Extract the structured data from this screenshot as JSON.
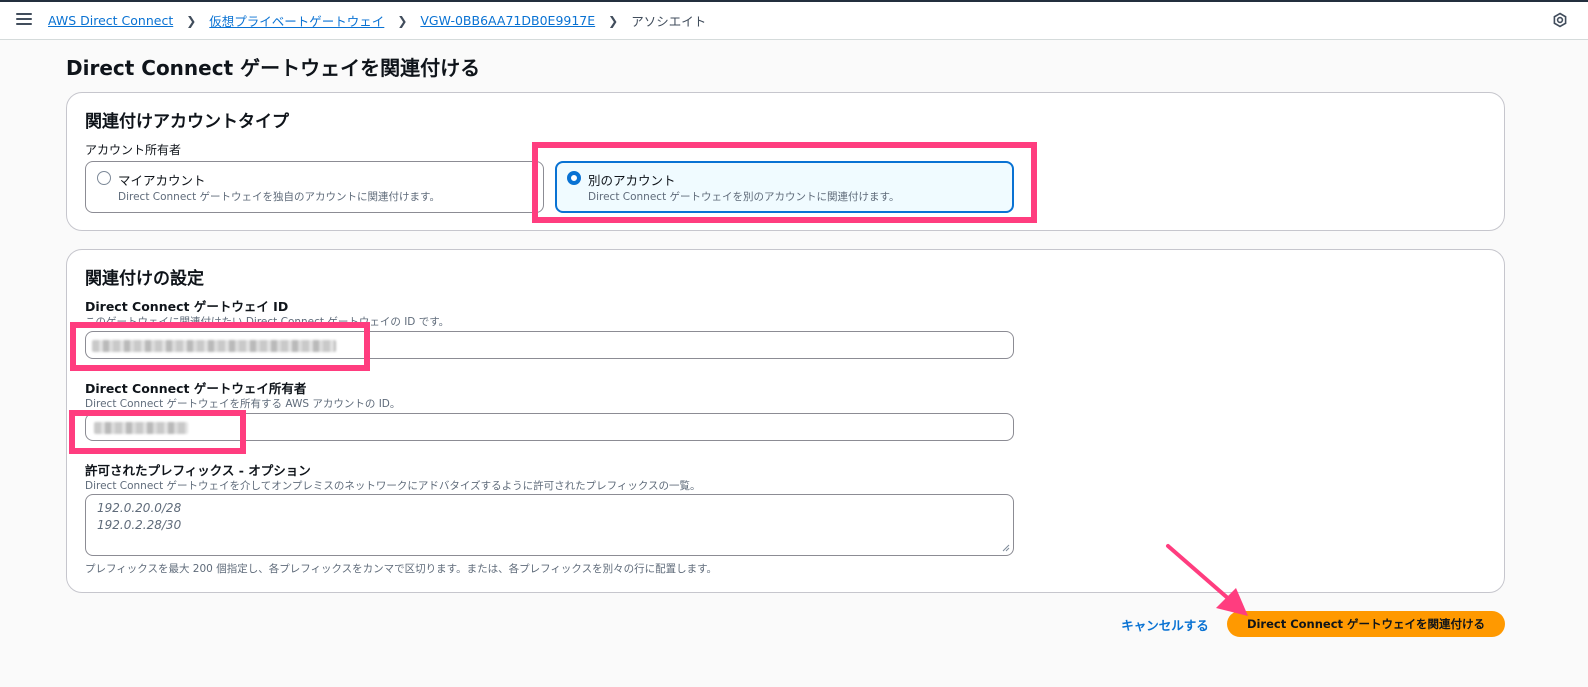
{
  "header": {
    "breadcrumbs": [
      "AWS Direct Connect",
      "仮想プライベートゲートウェイ",
      "VGW-0BB6AA71DB0E9917E"
    ],
    "current": "アソシエイト"
  },
  "page": {
    "title": "Direct Connect ゲートウェイを関連付ける"
  },
  "account_type": {
    "heading": "関連付けアカウントタイプ",
    "owner_label": "アカウント所有者",
    "options": [
      {
        "title": "マイアカウント",
        "description": "Direct Connect ゲートウェイを独自のアカウントに関連付けます。",
        "selected": false
      },
      {
        "title": "別のアカウント",
        "description": "Direct Connect ゲートウェイを別のアカウントに関連付けます。",
        "selected": true
      }
    ]
  },
  "settings": {
    "heading": "関連付けの設定",
    "gateway_id": {
      "label": "Direct Connect ゲートウェイ ID",
      "description": "このゲートウェイに関連付けたい Direct Connect ゲートウェイの ID です。"
    },
    "gateway_owner": {
      "label": "Direct Connect ゲートウェイ所有者",
      "description": "Direct Connect ゲートウェイを所有する AWS アカウントの ID。"
    },
    "prefixes": {
      "label": "許可されたプレフィックス - オプション",
      "description": "Direct Connect ゲートウェイを介してオンプレミスのネットワークにアドバタイズするように許可されたプレフィックスの一覧。",
      "placeholder_lines": [
        "192.0.20.0/28",
        "192.0.2.28/30"
      ],
      "hint": "プレフィックスを最大 200 個指定し、各プレフィックスをカンマで区切ります。または、各プレフィックスを別々の行に配置します。"
    }
  },
  "actions": {
    "cancel": "キャンセルする",
    "submit": "Direct Connect ゲートウェイを関連付ける"
  },
  "colors": {
    "link": "#0972d3",
    "primary_button": "#ff9900",
    "highlight": "#ff3d7f"
  }
}
